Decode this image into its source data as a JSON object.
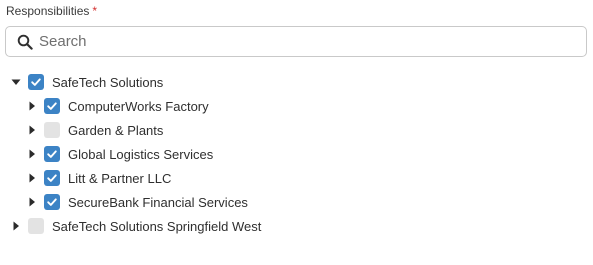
{
  "field": {
    "label": "Responsibilities",
    "required_mark": "*"
  },
  "search": {
    "placeholder": "Search",
    "value": "",
    "icon": "search-icon"
  },
  "colors": {
    "checked": "#3c83c5",
    "unchecked": "#e3e3e3",
    "required": "#d32f2f"
  },
  "tree": [
    {
      "label": "SafeTech Solutions",
      "expanded": true,
      "checked": true,
      "children": [
        {
          "label": "ComputerWorks Factory",
          "expanded": false,
          "checked": true
        },
        {
          "label": "Garden & Plants",
          "expanded": false,
          "checked": false
        },
        {
          "label": "Global Logistics Services",
          "expanded": false,
          "checked": true
        },
        {
          "label": "Litt & Partner LLC",
          "expanded": false,
          "checked": true
        },
        {
          "label": "SecureBank Financial Services",
          "expanded": false,
          "checked": true
        }
      ]
    },
    {
      "label": "SafeTech Solutions Springfield West",
      "expanded": false,
      "checked": false,
      "children": []
    }
  ]
}
